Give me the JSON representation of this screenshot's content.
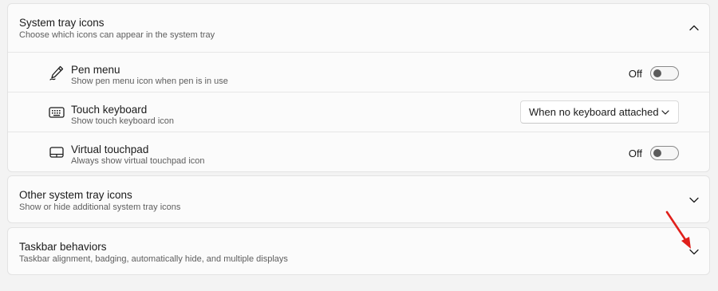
{
  "system_tray": {
    "title": "System tray icons",
    "subtitle": "Choose which icons can appear in the system tray",
    "expanded": true,
    "items": [
      {
        "title": "Pen menu",
        "subtitle": "Show pen menu icon when pen is in use",
        "icon": "pen-icon",
        "control": "toggle",
        "state_label": "Off",
        "on": false
      },
      {
        "title": "Touch keyboard",
        "subtitle": "Show touch keyboard icon",
        "icon": "keyboard-icon",
        "control": "dropdown",
        "selected": "When no keyboard attached"
      },
      {
        "title": "Virtual touchpad",
        "subtitle": "Always show virtual touchpad icon",
        "icon": "touchpad-icon",
        "control": "toggle",
        "state_label": "Off",
        "on": false
      }
    ]
  },
  "other_tray": {
    "title": "Other system tray icons",
    "subtitle": "Show or hide additional system tray icons",
    "expanded": false
  },
  "taskbar_behaviors": {
    "title": "Taskbar behaviors",
    "subtitle": "Taskbar alignment, badging, automatically hide, and multiple displays",
    "expanded": false
  },
  "colors": {
    "background": "#f3f3f3",
    "card": "#fbfbfb",
    "annotation_arrow": "#e0201b"
  }
}
